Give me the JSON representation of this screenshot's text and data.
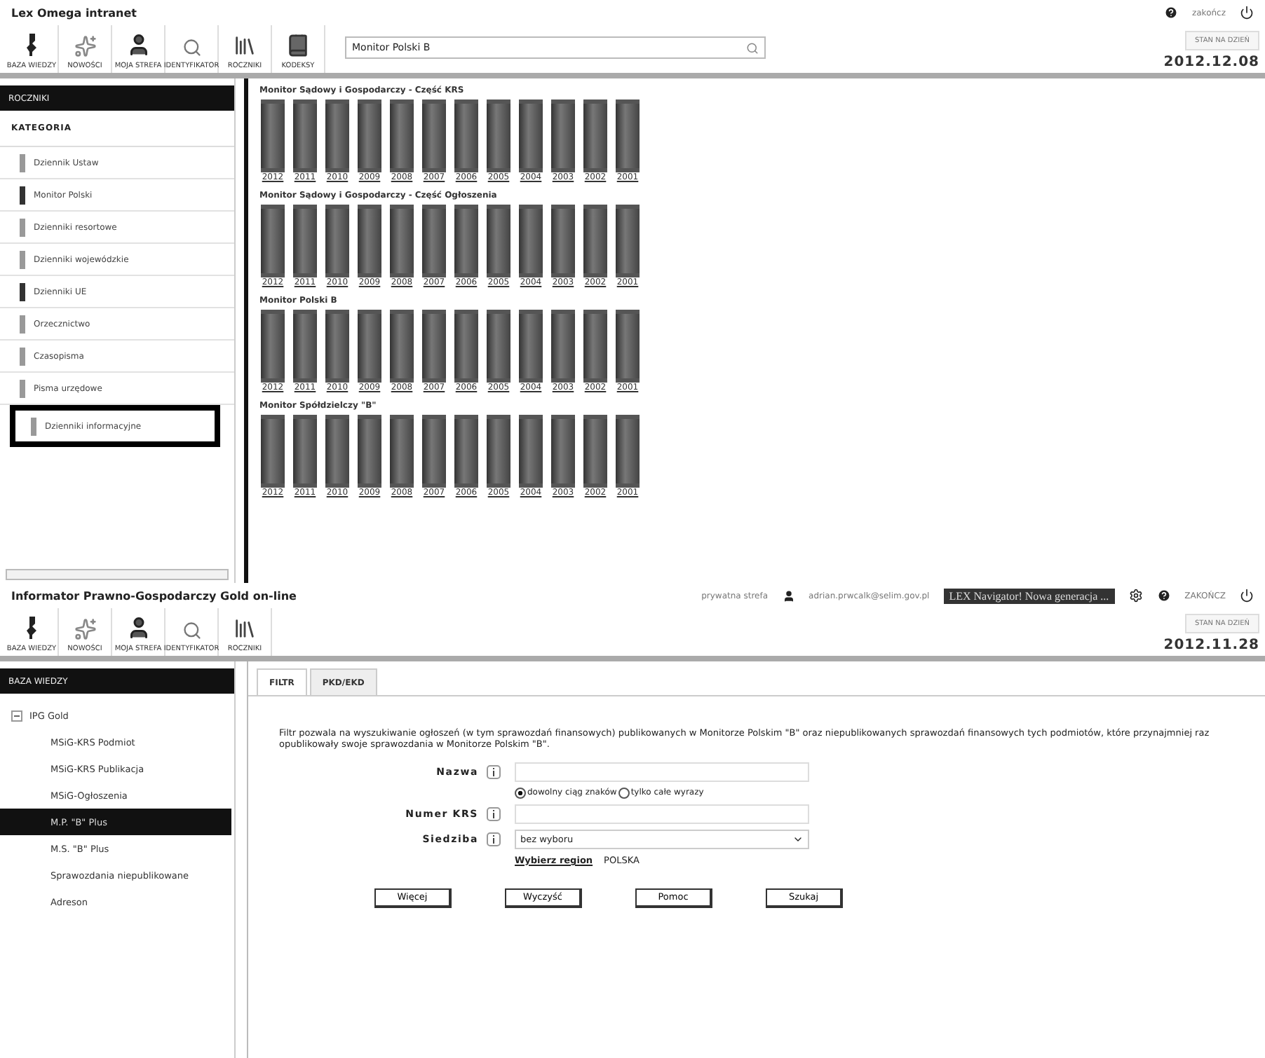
{
  "top_window": {
    "title": "Lex Omega intranet",
    "logout": "zakończ",
    "toolbar": [
      {
        "kind": "figure",
        "label": "BAZA WIEDZY"
      },
      {
        "kind": "sparkle",
        "label": "NOWOŚCI"
      },
      {
        "kind": "person",
        "label": "MOJA STREFA"
      },
      {
        "kind": "search",
        "label": "IDENTYFIKATOR"
      },
      {
        "kind": "books",
        "label": "ROCZNIKI"
      },
      {
        "kind": "book",
        "label": "KODEKSY"
      }
    ],
    "search": {
      "value": "Monitor Polski B"
    },
    "date_button": "STAN NA DZIEŃ",
    "date": "2012.12.08",
    "sidebar": {
      "header": "ROCZNIKI",
      "category": "KATEGORIA",
      "items": [
        {
          "label": "Dziennik Ustaw",
          "dark": false,
          "highlighted": false
        },
        {
          "label": "Monitor Polski",
          "dark": true,
          "highlighted": false
        },
        {
          "label": "Dzienniki resortowe",
          "dark": false,
          "highlighted": false
        },
        {
          "label": "Dzienniki wojewódzkie",
          "dark": false,
          "highlighted": false
        },
        {
          "label": "Dzienniki UE",
          "dark": true,
          "highlighted": false
        },
        {
          "label": "Orzecznictwo",
          "dark": false,
          "highlighted": false
        },
        {
          "label": "Czasopisma",
          "dark": false,
          "highlighted": false
        },
        {
          "label": "Pisma urzędowe",
          "dark": false,
          "highlighted": false
        },
        {
          "label": "Dzienniki informacyjne",
          "dark": false,
          "highlighted": true
        }
      ]
    },
    "sections": [
      {
        "title": "Monitor Sądowy i Gospodarczy - Część KRS",
        "years": [
          "2012",
          "2011",
          "2010",
          "2009",
          "2008",
          "2007",
          "2006",
          "2005",
          "2004",
          "2003",
          "2002",
          "2001"
        ]
      },
      {
        "title": "Monitor Sądowy i Gospodarczy - Część Ogłoszenia",
        "years": [
          "2012",
          "2011",
          "2010",
          "2009",
          "2008",
          "2007",
          "2006",
          "2005",
          "2004",
          "2003",
          "2002",
          "2001"
        ]
      },
      {
        "title": "Monitor Polski B",
        "years": [
          "2012",
          "2011",
          "2010",
          "2009",
          "2008",
          "2007",
          "2006",
          "2005",
          "2004",
          "2003",
          "2002",
          "2001"
        ]
      },
      {
        "title": "Monitor Spółdzielczy \"B\"",
        "years": [
          "2012",
          "2011",
          "2010",
          "2009",
          "2008",
          "2007",
          "2006",
          "2005",
          "2004",
          "2003",
          "2002",
          "2001"
        ]
      }
    ]
  },
  "bottom_window": {
    "title": "Informator Prawno-Gospodarczy Gold on-line",
    "private_zone": "prywatna strefa",
    "user": "adrian.prwcalk@selim.gov.pl",
    "banner": "LEX Navigator! Nowa generacja ...",
    "logout": "ZAKOŃCZ",
    "toolbar": [
      {
        "kind": "figure",
        "label": "BAZA WIEDZY"
      },
      {
        "kind": "sparkle",
        "label": "NOWOŚCI"
      },
      {
        "kind": "person",
        "label": "MOJA STREFA"
      },
      {
        "kind": "search",
        "label": "IDENTYFIKATOR"
      },
      {
        "kind": "books",
        "label": "ROCZNIKI"
      }
    ],
    "date_button": "STAN NA DZIEŃ",
    "date": "2012.11.28",
    "sidebar": {
      "header": "BAZA WIEDZY",
      "tree": [
        {
          "label": "IPG Gold",
          "expanded": true,
          "selected": false,
          "children": [
            {
              "label": "MSiG-KRS Podmiot",
              "selected": false
            },
            {
              "label": "MSiG-KRS Publikacja",
              "selected": false
            },
            {
              "label": "MSiG-Ogłoszenia",
              "selected": false
            },
            {
              "label": "M.P. \"B\" Plus",
              "selected": true
            },
            {
              "label": "M.S. \"B\" Plus",
              "selected": false
            },
            {
              "label": "Sprawozdania niepublikowane",
              "selected": false
            },
            {
              "label": "Adreson",
              "selected": false
            }
          ]
        }
      ]
    },
    "tabs": [
      {
        "label": "FILTR",
        "selected": true
      },
      {
        "label": "PKD/EKD",
        "selected": false
      }
    ],
    "description": "Filtr pozwala na wyszukiwanie ogłoszeń (w tym sprawozdań finansowych) publikowanych w Monitorze Polskim \"B\" oraz niepublikowanych sprawozdań finansowych tych podmiotów, które przynajmniej raz opublikowały swoje sprawozdania w Monitorze Polskim \"B\".",
    "form": {
      "name_label": "Nazwa",
      "match_options": [
        {
          "label": "dowolny ciąg znaków",
          "selected": true
        },
        {
          "label": "tylko całe wyrazy",
          "selected": false
        }
      ],
      "krs_label": "Numer KRS",
      "seat_label": "Siedziba",
      "seat_value": "bez wyboru",
      "region_link": "Wybierz region",
      "region_value": "POLSKA"
    },
    "buttons": [
      "Więcej",
      "Wyczyść",
      "Pomoc",
      "Szukaj"
    ]
  }
}
